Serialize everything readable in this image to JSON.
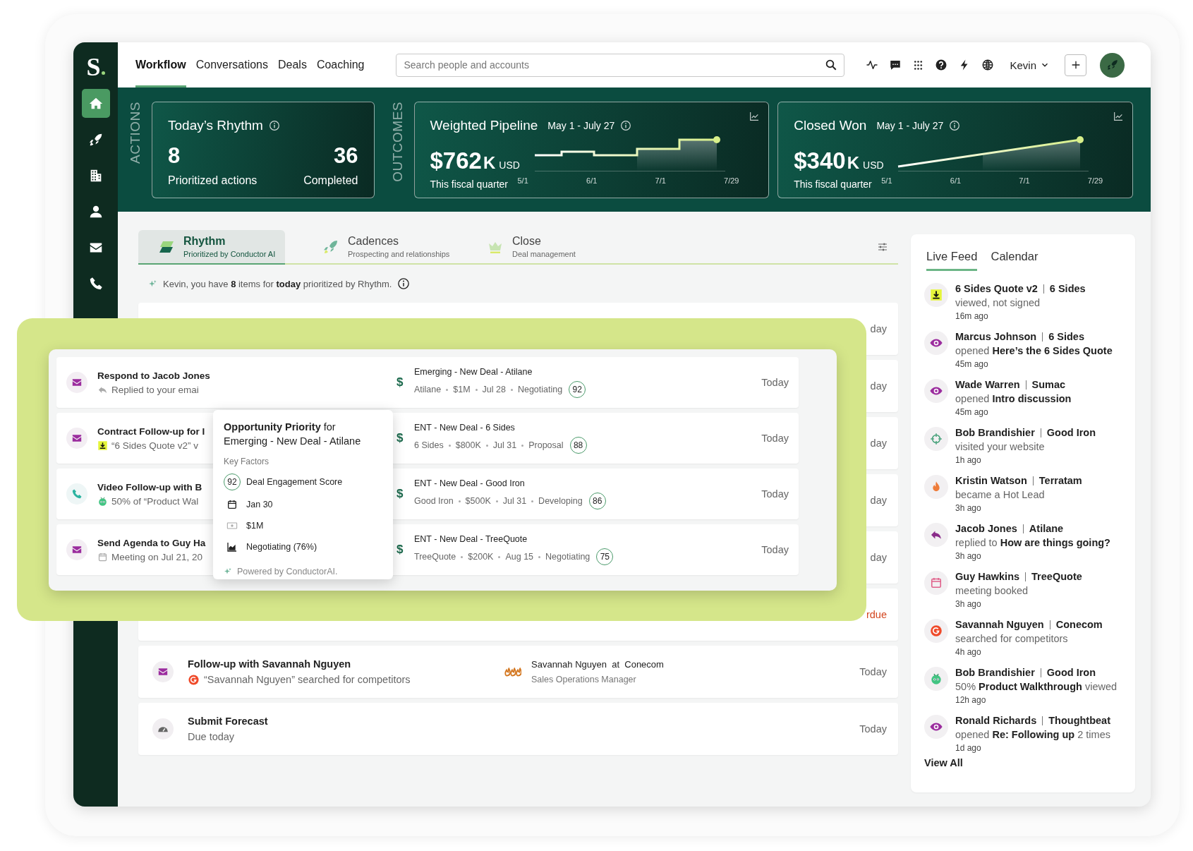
{
  "sidebar": {
    "logo": "S",
    "items": [
      {
        "kind": "home",
        "selected": true
      },
      {
        "kind": "rocket",
        "selected": false
      },
      {
        "kind": "building",
        "selected": false
      },
      {
        "kind": "person",
        "selected": false
      },
      {
        "kind": "mail",
        "selected": false
      },
      {
        "kind": "phone",
        "selected": false
      }
    ]
  },
  "top_nav": [
    {
      "label": "Workflow",
      "selected": true
    },
    {
      "label": "Conversations",
      "selected": false
    },
    {
      "label": "Deals",
      "selected": false
    },
    {
      "label": "Coaching",
      "selected": false
    }
  ],
  "search": {
    "placeholder": "Search people and accounts"
  },
  "toolbar_icons": [
    {
      "kind": "activity"
    },
    {
      "kind": "chat"
    },
    {
      "kind": "grid"
    },
    {
      "kind": "help"
    },
    {
      "kind": "bolt"
    },
    {
      "kind": "globe"
    }
  ],
  "user": {
    "name": "Kevin"
  },
  "kpi_band": {
    "actions_label": "ACTIONS",
    "outcomes_label": "OUTCOMES",
    "rhythm": {
      "title": "Today’s Rhythm",
      "prioritized": "8",
      "prioritized_label": "Prioritized actions",
      "completed": "36",
      "completed_label": "Completed"
    },
    "outcomes": [
      {
        "kind": "steps",
        "title": "Weighted Pipeline",
        "range": "May 1 - July 27",
        "amount": "$762",
        "unit": "K",
        "currency": "USD",
        "period": "This fiscal quarter",
        "x_labels": [
          "5/1",
          "6/1",
          "7/1",
          "7/29"
        ]
      },
      {
        "kind": "ramp",
        "title": "Closed Won",
        "range": "May 1 - July 27",
        "amount": "$340",
        "unit": "K",
        "currency": "USD",
        "period": "This fiscal quarter",
        "x_labels": [
          "5/1",
          "6/1",
          "7/1",
          "7/29"
        ]
      }
    ]
  },
  "work_tabs": [
    {
      "kind": "rhythm",
      "label": "Rhythm",
      "subtitle": "Prioritized by Conductor AI",
      "selected": true
    },
    {
      "kind": "cadences",
      "label": "Cadences",
      "subtitle": "Prospecting and relationships",
      "selected": false
    },
    {
      "kind": "close",
      "label": "Close",
      "subtitle": "Deal management",
      "selected": false
    }
  ],
  "summary": "Kevin, you have **8** items for **today** prioritized by Rhythm.",
  "tasks": [
    {
      "kind": "covered",
      "date": "day",
      "overdue": false
    },
    {
      "kind": "covered",
      "date": "day",
      "overdue": false
    },
    {
      "kind": "covered",
      "date": "day",
      "overdue": false
    },
    {
      "kind": "covered",
      "date": "day",
      "overdue": false
    },
    {
      "kind": "covered",
      "date": "day",
      "overdue": false
    },
    {
      "kind": "covered",
      "date": "rdue",
      "overdue": true
    },
    {
      "kind": "email",
      "title": "Follow-up with Savannah Nguyen",
      "note": {
        "kind": "g2",
        "text": "“Savannah Nguyen” searched for competitors"
      },
      "contact": "Savannah Nguyen  at  Conecom",
      "role": "Sales Operations Manager",
      "date": "Today",
      "overdue": false
    },
    {
      "kind": "forecast",
      "title": "Submit Forecast",
      "note": {
        "kind": "plain",
        "text": "Due today"
      },
      "date": "Today",
      "overdue": false
    }
  ],
  "spotlight": {
    "rows": [
      {
        "kind": "email",
        "title": "Respond to Jacob Jones",
        "note": {
          "kind": "reply",
          "text": "Replied to your emai"
        },
        "deal_symbol": "$",
        "deal": "Emerging - New Deal - Atilane",
        "deal_meta": [
          "Atilane",
          "$1M",
          "Jul 28",
          "Negotiating"
        ],
        "score": "92",
        "date": "Today"
      },
      {
        "kind": "email",
        "title": "Contract Follow-up for I",
        "note": {
          "kind": "download",
          "text": "“6 Sides Quote v2” v"
        },
        "deal_symbol": "$",
        "deal": "ENT - New Deal - 6 Sides",
        "deal_meta": [
          "6 Sides",
          "$800K",
          "Jul 31",
          "Proposal"
        ],
        "score": "88",
        "date": "Today"
      },
      {
        "kind": "call",
        "title": "Video Follow-up with B",
        "note": {
          "kind": "video",
          "text": "50% of “Product Wal"
        },
        "deal_symbol": "$",
        "deal": "ENT - New Deal - Good Iron",
        "deal_meta": [
          "Good Iron",
          "$500K",
          "Jul 31",
          "Developing"
        ],
        "score": "86",
        "date": "Today"
      },
      {
        "kind": "email",
        "title": "Send Agenda to Guy Ha",
        "note": {
          "kind": "meeting",
          "text": "Meeting on Jul 21, 20"
        },
        "deal_symbol": "$",
        "deal": "ENT - New Deal - TreeQuote",
        "deal_meta": [
          "TreeQuote",
          "$200K",
          "Aug 15",
          "Negotiating"
        ],
        "score": "75",
        "date": "Today"
      }
    ],
    "popover": {
      "title": "**Opportunity Priority** for Emerging - New Deal - Atilane",
      "section": "Key Factors",
      "factors": [
        {
          "kind": "score",
          "score": "92",
          "label": "Deal Engagement Score"
        },
        {
          "kind": "date",
          "label": "Jan 30"
        },
        {
          "kind": "amount",
          "label": "$1M"
        },
        {
          "kind": "stage",
          "label": "Negotiating (76%)"
        }
      ],
      "footer": "Powered by ConductorAI."
    }
  },
  "feed": {
    "tabs": [
      {
        "label": "Live Feed",
        "selected": true
      },
      {
        "label": "Calendar",
        "selected": false
      }
    ],
    "items": [
      {
        "kind": "document",
        "name": "6 Sides Quote v2",
        "company": "6 Sides",
        "detail": "viewed, not signed",
        "time": "16m ago"
      },
      {
        "kind": "email_open",
        "name": "Marcus Johnson",
        "company": "6 Sides",
        "detail": "opened **Here’s the 6 Sides Quote**",
        "time": "45m ago"
      },
      {
        "kind": "email_open",
        "name": "Wade Warren",
        "company": "Sumac",
        "detail": "opened **Intro discussion**",
        "time": "45m ago"
      },
      {
        "kind": "web_visit",
        "name": "Bob Brandishier",
        "company": "Good Iron",
        "detail": "visited your website",
        "time": "1h ago"
      },
      {
        "kind": "hot_lead",
        "name": "Kristin Watson",
        "company": "Terratam",
        "detail": "became a Hot Lead",
        "time": "3h ago"
      },
      {
        "kind": "reply",
        "name": "Jacob Jones",
        "company": "Atilane",
        "detail": "replied to **How are things going?**",
        "time": "3h ago"
      },
      {
        "kind": "meeting",
        "name": "Guy Hawkins",
        "company": "TreeQuote",
        "detail": "meeting booked",
        "time": "3h ago"
      },
      {
        "kind": "g2",
        "name": "Savannah Nguyen",
        "company": "Conecom",
        "detail": "searched for competitors",
        "time": "4h ago"
      },
      {
        "kind": "video",
        "name": "Bob Brandishier",
        "company": "Good Iron",
        "detail": "50% **Product Walkthrough** viewed",
        "time": "12h ago"
      },
      {
        "kind": "email_open",
        "name": "Ronald Richards",
        "company": "Thoughtbeat",
        "detail": "opened **Re: Following up** 2 times",
        "time": "1d ago"
      }
    ],
    "view_all": "View All"
  }
}
